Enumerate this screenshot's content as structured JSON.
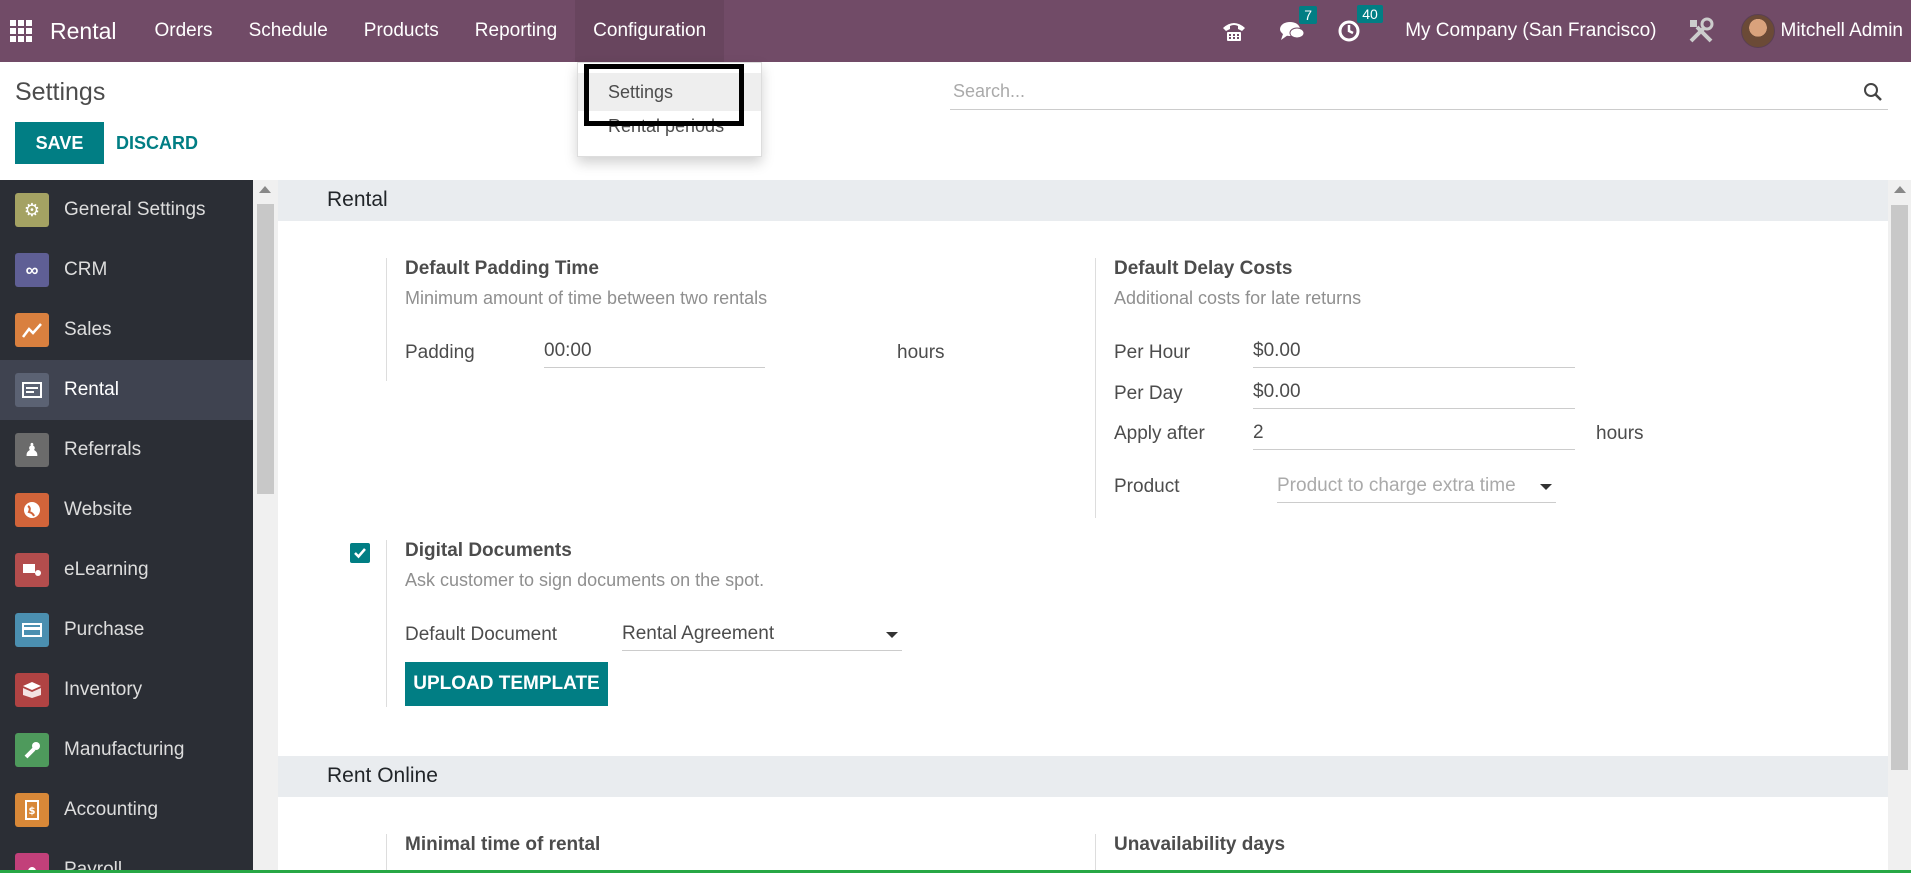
{
  "navbar": {
    "brand": "Rental",
    "menu": [
      "Orders",
      "Schedule",
      "Products",
      "Reporting",
      "Configuration"
    ],
    "messages_count": "7",
    "activities_count": "40",
    "company": "My Company (San Francisco)",
    "user": "Mitchell Admin"
  },
  "control_panel": {
    "title": "Settings",
    "save_label": "SAVE",
    "discard_label": "DISCARD",
    "search_placeholder": "Search..."
  },
  "config_dropdown": {
    "items": [
      "Settings",
      "Rental periods"
    ]
  },
  "sidebar": {
    "items": [
      {
        "label": "General Settings",
        "icon": "gear-icon",
        "color": "#a4a263"
      },
      {
        "label": "CRM",
        "icon": "handshake-icon",
        "color": "#5f5f95"
      },
      {
        "label": "Sales",
        "icon": "chart-icon",
        "color": "#d9803f"
      },
      {
        "label": "Rental",
        "icon": "rental-icon",
        "color": "#5b6273"
      },
      {
        "label": "Referrals",
        "icon": "referrals-icon",
        "color": "#6b6b6b"
      },
      {
        "label": "Website",
        "icon": "globe-icon",
        "color": "#d1643a"
      },
      {
        "label": "eLearning",
        "icon": "elearning-icon",
        "color": "#b34d4d"
      },
      {
        "label": "Purchase",
        "icon": "card-icon",
        "color": "#4b8fb0"
      },
      {
        "label": "Inventory",
        "icon": "box-icon",
        "color": "#b04343"
      },
      {
        "label": "Manufacturing",
        "icon": "wrench-icon",
        "color": "#4e9a5c"
      },
      {
        "label": "Accounting",
        "icon": "invoice-icon",
        "color": "#d88838"
      },
      {
        "label": "Payroll",
        "icon": "payroll-icon",
        "color": "#c2407a"
      }
    ]
  },
  "rental_section": {
    "title": "Rental",
    "padding": {
      "title": "Default Padding Time",
      "desc": "Minimum amount of time between two rentals",
      "label": "Padding",
      "value": "00:00",
      "unit": "hours"
    },
    "delay": {
      "title": "Default Delay Costs",
      "desc": "Additional costs for late returns",
      "per_hour_label": "Per Hour",
      "per_hour_value": "$0.00",
      "per_day_label": "Per Day",
      "per_day_value": "$0.00",
      "apply_after_label": "Apply after",
      "apply_after_value": "2",
      "apply_after_unit": "hours",
      "product_label": "Product",
      "product_placeholder": "Product to charge extra time"
    },
    "digital": {
      "title": "Digital Documents",
      "desc": "Ask customer to sign documents on the spot.",
      "checked": true,
      "doc_label": "Default Document",
      "doc_value": "Rental Agreement",
      "upload_label": "UPLOAD TEMPLATE"
    }
  },
  "rent_online_section": {
    "title": "Rent Online",
    "minimal_title": "Minimal time of rental",
    "unavailability_title": "Unavailability days"
  },
  "colors": {
    "navbar": "#714b67",
    "accent": "#017e84"
  }
}
